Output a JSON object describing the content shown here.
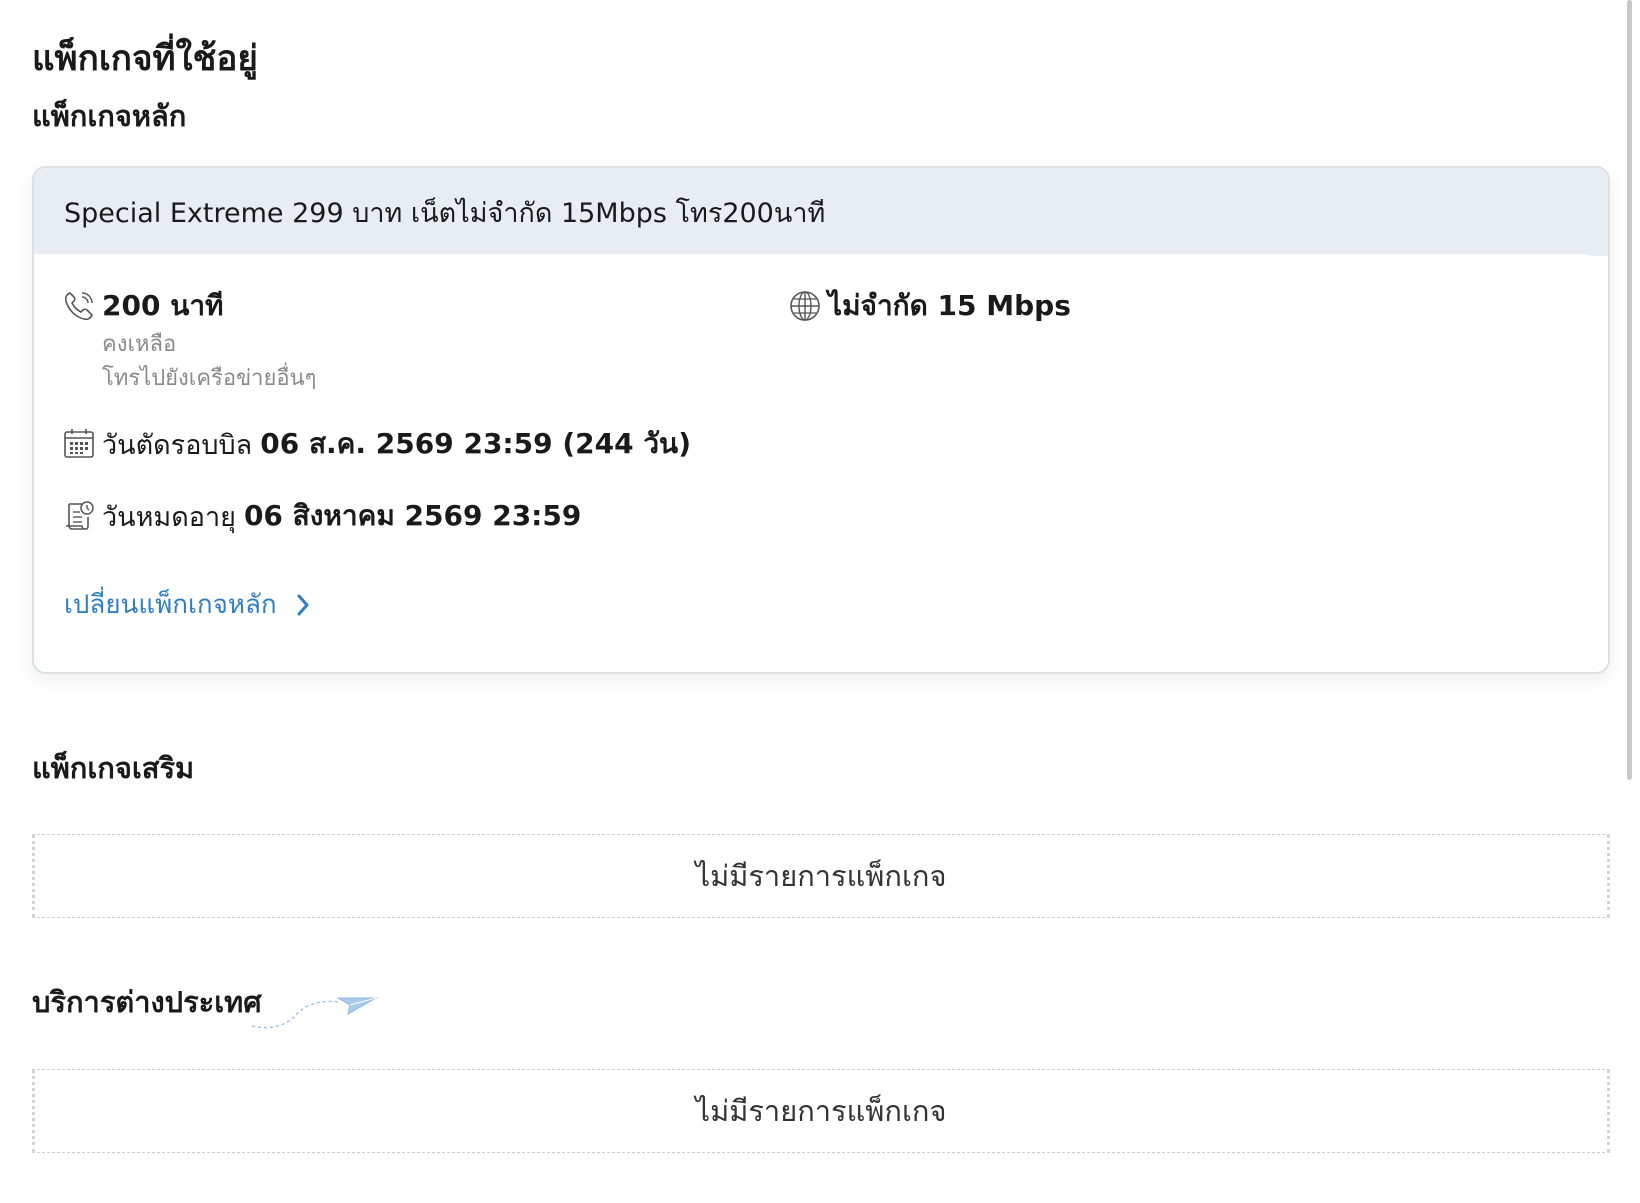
{
  "page": {
    "title": "แพ็กเกจที่ใช้อยู่"
  },
  "main_package": {
    "section_title": "แพ็กเกจหลัก",
    "name": "Special Extreme 299 บาท เน็ตไม่จำกัด 15Mbps โทร200นาที",
    "voice": {
      "amount": "200 นาที",
      "remaining_label": "คงเหลือ",
      "scope": "โทรไปยังเครือข่ายอื่นๆ",
      "icon": "phone-icon"
    },
    "data": {
      "amount": "ไม่จำกัด 15 Mbps",
      "icon": "globe-icon"
    },
    "bill_cycle": {
      "label": "วันตัดรอบบิล",
      "value": "06 ส.ค. 2569 23:59 (244 วัน)",
      "icon": "calendar-icon"
    },
    "expiry": {
      "label": "วันหมดอายุ",
      "value": "06 สิงหาคม 2569 23:59",
      "icon": "expiry-document-icon"
    },
    "change_link": "เปลี่ยนแพ็กเกจหลัก"
  },
  "addon_package": {
    "section_title": "แพ็กเกจเสริม",
    "empty_text": "ไม่มีรายการแพ็กเกจ"
  },
  "international": {
    "section_title": "บริการต่างประเทศ",
    "empty_text": "ไม่มีรายการแพ็กเกจ",
    "icon": "paper-plane-icon"
  },
  "colors": {
    "link": "#2f7fc4",
    "card_header_bg": "#e8edf4",
    "muted_text": "#8a8a8a"
  }
}
